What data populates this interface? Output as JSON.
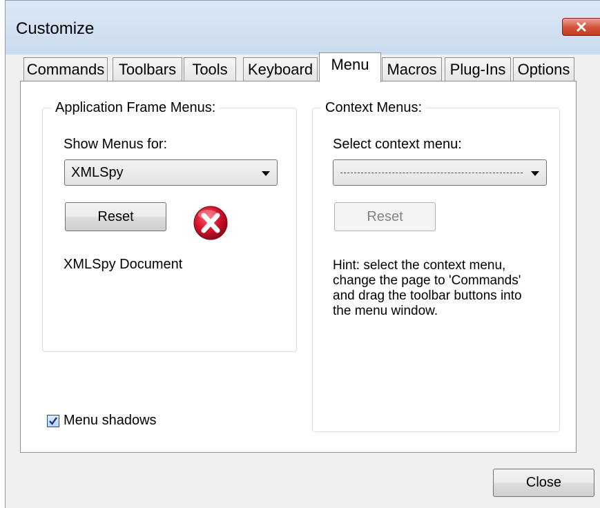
{
  "window": {
    "title": "Customize"
  },
  "tabs": [
    {
      "label": "Commands",
      "active": false
    },
    {
      "label": "Toolbars",
      "active": false
    },
    {
      "label": "Tools",
      "active": false
    },
    {
      "label": "Keyboard",
      "active": false
    },
    {
      "label": "Menu",
      "active": true
    },
    {
      "label": "Macros",
      "active": false
    },
    {
      "label": "Plug-Ins",
      "active": false
    },
    {
      "label": "Options",
      "active": false
    }
  ],
  "app_frame": {
    "legend": "Application Frame Menus:",
    "show_label": "Show Menus for:",
    "selected": "XMLSpy",
    "reset_label": "Reset",
    "document_label": "XMLSpy Document"
  },
  "context": {
    "legend": "Context Menus:",
    "select_label": "Select context menu:",
    "selected": "",
    "reset_label": "Reset",
    "hint_lines": [
      "Hint: select the context menu,",
      "change the page to 'Commands'",
      "and drag the toolbar buttons into",
      "the menu window."
    ]
  },
  "menu_shadows": {
    "label": "Menu shadows",
    "checked": true
  },
  "footer": {
    "close_label": "Close"
  },
  "colors": {
    "close_x": "#c9442a",
    "error_icon": "#d0112b"
  }
}
